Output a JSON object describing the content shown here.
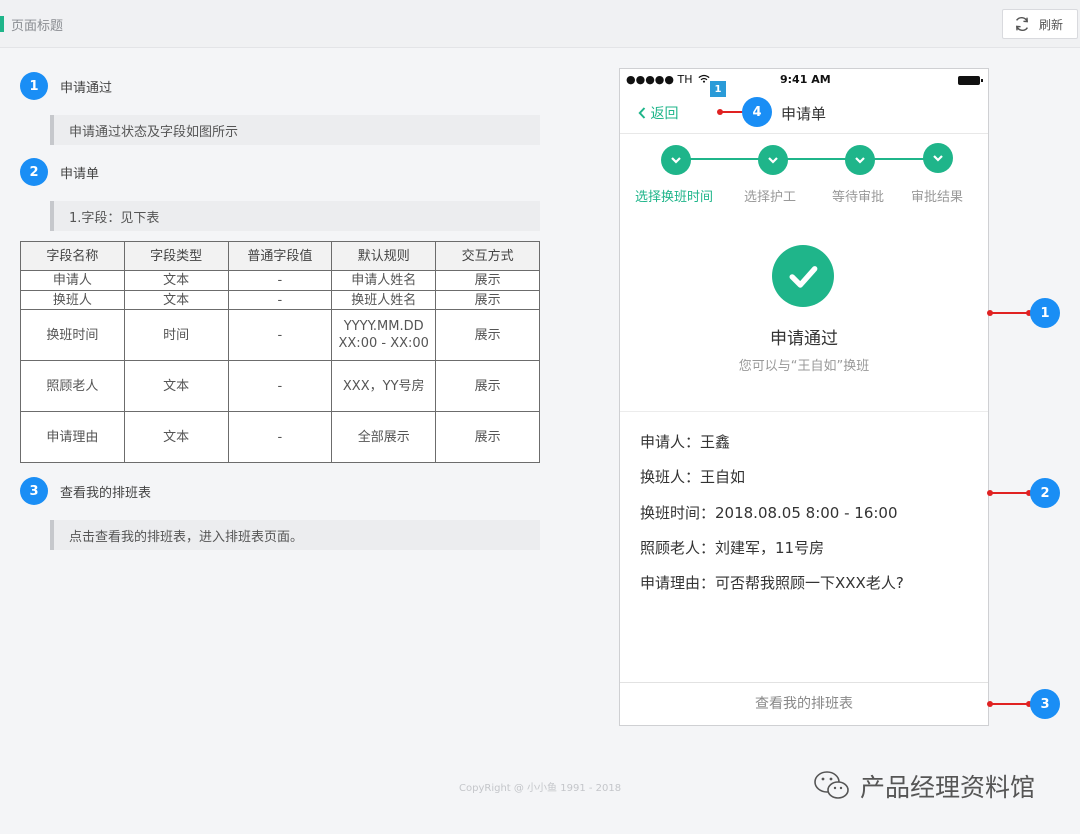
{
  "header": {
    "title": "页面标题",
    "refresh_label": "刷新"
  },
  "sections": [
    {
      "num": "1",
      "title": "申请通过",
      "note": "申请通过状态及字段如图所示"
    },
    {
      "num": "2",
      "title": "申请单",
      "note": "1.字段：见下表"
    },
    {
      "num": "3",
      "title": "查看我的排班表",
      "note": "点击查看我的排班表，进入排班表页面。"
    }
  ],
  "table": {
    "headers": [
      "字段名称",
      "字段类型",
      "普通字段值",
      "默认规则",
      "交互方式"
    ],
    "rows": [
      [
        "申请人",
        "文本",
        "-",
        "申请人姓名",
        "展示"
      ],
      [
        "换班人",
        "文本",
        "-",
        "换班人姓名",
        "展示"
      ],
      [
        "换班时间",
        "时间",
        "-",
        "YYYY.MM.DD\nXX:00 - XX:00",
        "展示"
      ],
      [
        "照顾老人",
        "文本",
        "-",
        "XXX，YY号房",
        "展示"
      ],
      [
        "申请理由",
        "文本",
        "-",
        "全部展示",
        "展示"
      ]
    ]
  },
  "phone": {
    "status": {
      "signal": "●●●●● TH",
      "time": "9:41 AM"
    },
    "nav": {
      "back_label": "返回",
      "title": "申请单"
    },
    "steps": [
      "选择换班时间",
      "选择护工",
      "等待审批",
      "审批结果"
    ],
    "active_step": 0,
    "result": {
      "title": "申请通过",
      "subtitle": "您可以与“王自如”换班"
    },
    "info": [
      "申请人：王鑫",
      "换班人：王自如",
      "换班时间：2018.08.05  8:00 - 16:00",
      "照顾老人：刘建军，11号房",
      "申请理由：可否帮我照顾一下XXX老人?"
    ],
    "bottom_button": "查看我的排班表"
  },
  "annotations": {
    "tiny_tag": "1",
    "nav": "4",
    "result": "1",
    "info": "2",
    "button": "3"
  },
  "footer": {
    "copyright": "CopyRight @ 小小鱼  1991 - 2018",
    "watermark": "产品经理资料馆"
  },
  "colors": {
    "accent_green": "#1fb58a",
    "badge_blue": "#1a8ef5",
    "pin_red": "#e02222"
  },
  "icons": [
    "refresh-icon",
    "chevron-left-icon",
    "check-icon",
    "wifi-icon",
    "wechat-icon"
  ]
}
